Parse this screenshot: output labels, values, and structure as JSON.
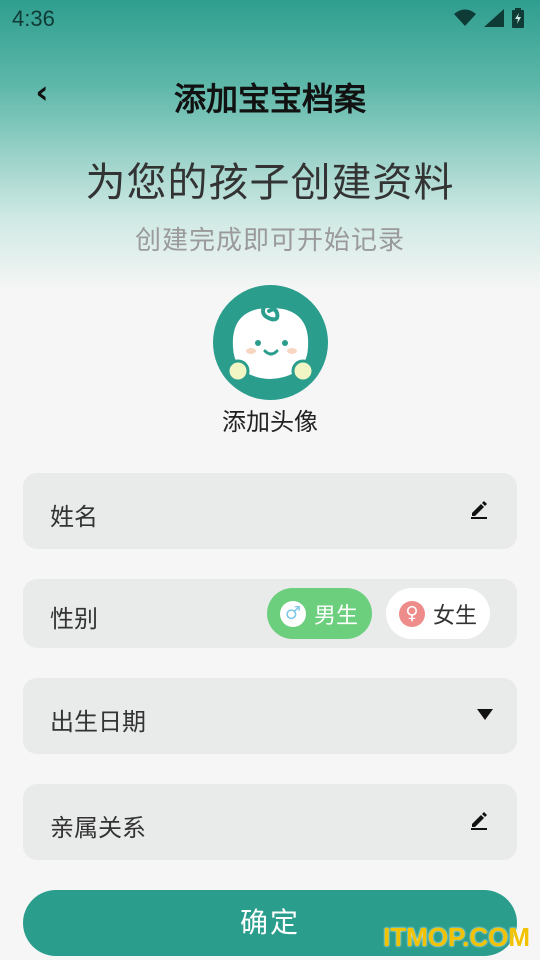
{
  "status_bar": {
    "time": "4:36"
  },
  "header": {
    "title": "添加宝宝档案"
  },
  "hero": {
    "title": "为您的孩子创建资料",
    "subtitle": "创建完成即可开始记录"
  },
  "avatar": {
    "label": "添加头像"
  },
  "form": {
    "name_label": "姓名",
    "gender_label": "性别",
    "gender_options": {
      "male": "男生",
      "female": "女生"
    },
    "selected_gender": "男生",
    "birth_label": "出生日期",
    "relation_label": "亲属关系"
  },
  "confirm_label": "确定",
  "watermark": "ITMOP.COM",
  "colors": {
    "accent": "#2a9d8d",
    "male": "#6ccf7e",
    "female": "#ee8c8c"
  }
}
